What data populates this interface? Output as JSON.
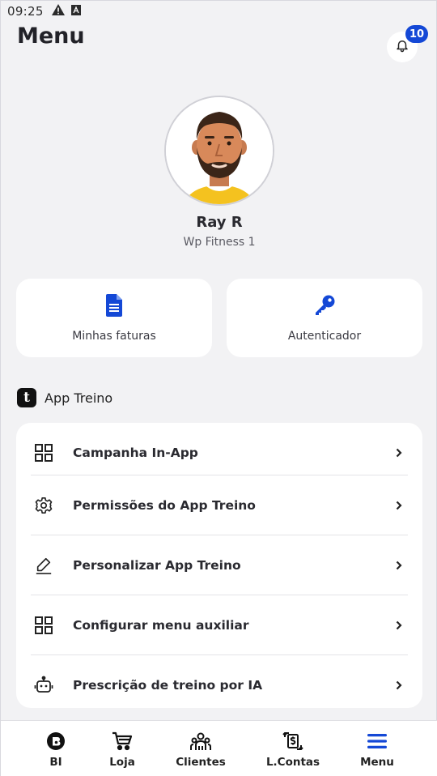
{
  "status_bar": {
    "time": "09:25",
    "icons": [
      "warning-icon",
      "font-a-icon"
    ]
  },
  "header": {
    "title": "Menu",
    "notification_icon": "bell-icon",
    "notification_count": "10"
  },
  "profile": {
    "name": "Ray R",
    "gym": "Wp Fitness 1"
  },
  "quick_actions": [
    {
      "label": "Minhas faturas",
      "icon": "document-icon"
    },
    {
      "label": "Autenticador",
      "icon": "key-icon"
    }
  ],
  "section": {
    "logo_letter": "t",
    "title": "App Treino"
  },
  "menu_items": [
    {
      "label": "Campanha In-App",
      "icon": "grid-icon"
    },
    {
      "label": "Permissões do App Treino",
      "icon": "gear-icon"
    },
    {
      "label": "Personalizar App Treino",
      "icon": "pen-icon"
    },
    {
      "label": "Configurar menu auxiliar",
      "icon": "grid-icon"
    },
    {
      "label": "Prescrição de treino por IA",
      "icon": "robot-icon"
    }
  ],
  "bottom_nav": [
    {
      "label": "BI",
      "icon": "bi-icon"
    },
    {
      "label": "Loja",
      "icon": "cart-icon"
    },
    {
      "label": "Clientes",
      "icon": "people-icon"
    },
    {
      "label": "L.Contas",
      "icon": "money-transfer-icon"
    },
    {
      "label": "Menu",
      "icon": "hamburger-icon",
      "active": true
    }
  ],
  "colors": {
    "accent": "#1448d6",
    "background": "#f2f2f4",
    "card": "#ffffff",
    "text": "#2a2a30"
  }
}
